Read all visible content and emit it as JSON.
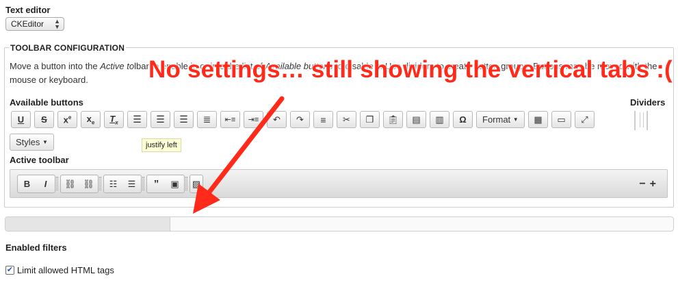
{
  "text_editor": {
    "label": "Text editor",
    "selected": "CKEditor"
  },
  "toolbar_config": {
    "legend": "TOOLBAR CONFIGURATION",
    "desc_prefix": "Move a button into the ",
    "desc_italic": "Active to",
    "desc_mid": "lbar to enable it, or into the list of ",
    "desc_italic2": "Available buttons",
    "desc_suffix": " to disable it. Use dividers to create button groups. Buttons may be moved with the mouse or keyboard.",
    "available_label": "Available buttons",
    "dividers_label": "Dividers",
    "format_label": "Format",
    "styles_label": "Styles",
    "tooltip": "justify left",
    "active_label": "Active toolbar"
  },
  "available_icons": [
    "underline-icon",
    "strikethrough-icon",
    "superscript-icon",
    "subscript-icon",
    "remove-format-icon",
    "align-left-icon",
    "align-center-icon",
    "align-right-icon",
    "justify-icon",
    "outdent-icon",
    "indent-icon",
    "undo-icon",
    "redo-icon",
    "horizontal-rule-icon",
    "cut-icon",
    "copy-icon",
    "paste-icon",
    "paste-text-icon",
    "paste-word-icon",
    "special-char-icon"
  ],
  "active_icons": [
    "bold-icon",
    "italic-icon",
    "link-icon",
    "unlink-icon",
    "bulleted-list-icon",
    "numbered-list-icon",
    "blockquote-icon",
    "image-icon",
    "source-icon"
  ],
  "progress": {
    "fraction": 0.247
  },
  "filters": {
    "label": "Enabled filters",
    "limit_label": "Limit allowed HTML tags",
    "limit_checked": true
  },
  "annotation": {
    "text": "No settings… still showing the vertical tabs :(",
    "color": "#ff2a1a"
  }
}
